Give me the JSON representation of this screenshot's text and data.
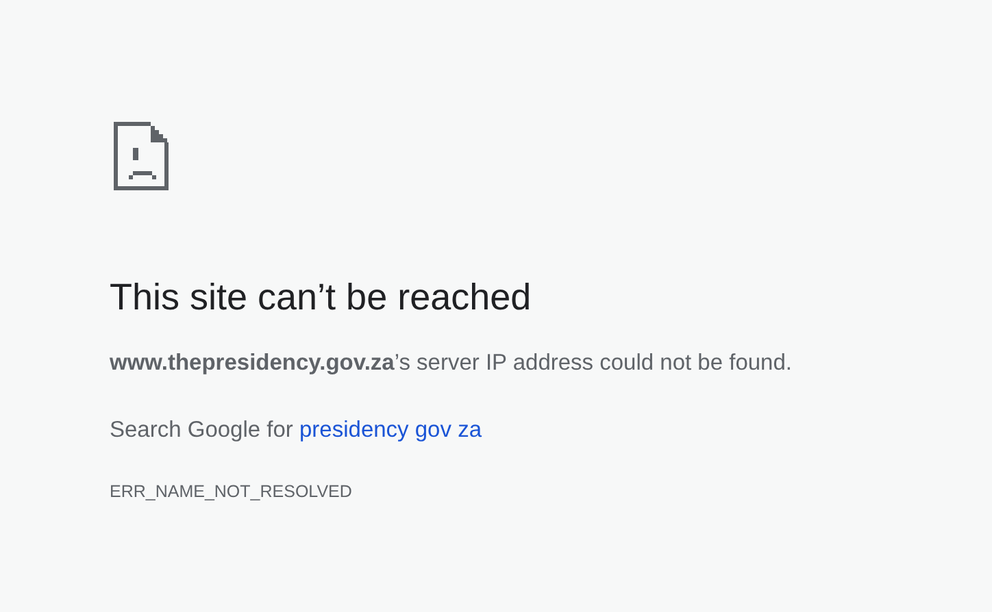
{
  "title": "This site can’t be reached",
  "message": "**www.thepresidency.gov.za**’s server IP address could not be found.",
  "search": {
    "prefix": "Search Google for",
    "link": "presidency gov za"
  },
  "error_code": "ERR_NAME_NOT_RESOLVED"
}
